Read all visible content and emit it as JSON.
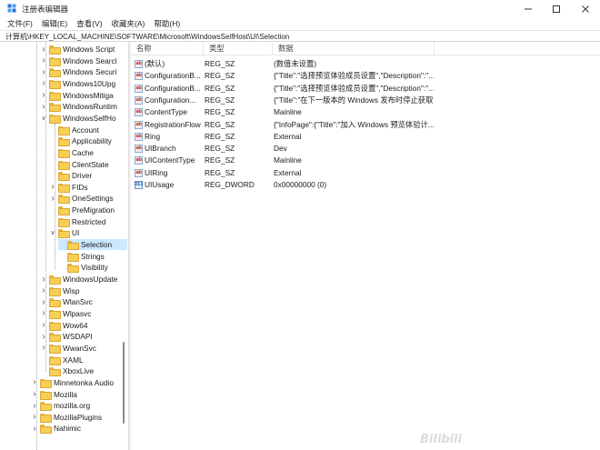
{
  "window": {
    "title": "注册表编辑器",
    "icons": {
      "app": "registry-editor-icon",
      "minimize": "minimize-icon",
      "maximize": "maximize-icon",
      "close": "close-icon"
    }
  },
  "menu": {
    "items": [
      {
        "label": "文件(F)"
      },
      {
        "label": "编辑(E)"
      },
      {
        "label": "查看(V)"
      },
      {
        "label": "收藏夹(A)"
      },
      {
        "label": "帮助(H)"
      }
    ]
  },
  "address": {
    "path": "计算机\\HKEY_LOCAL_MACHINE\\SOFTWARE\\Microsoft\\WindowsSelfHost\\UI\\Selection"
  },
  "tree": {
    "items": [
      {
        "label": "Windows Script",
        "expander": ">"
      },
      {
        "label": "Windows Searcl",
        "expander": ">"
      },
      {
        "label": "Windows Securi",
        "expander": ">"
      },
      {
        "label": "Windows10Upg",
        "expander": ">"
      },
      {
        "label": "WindowsMitiga",
        "expander": ">"
      },
      {
        "label": "WindowsRuntim",
        "expander": ">"
      },
      {
        "label": "WindowsSelfHo",
        "expander": "v"
      },
      {
        "label": "Account",
        "expander": ""
      },
      {
        "label": "Applicability",
        "expander": ""
      },
      {
        "label": "Cache",
        "expander": ""
      },
      {
        "label": "ClientState",
        "expander": ""
      },
      {
        "label": "Driver",
        "expander": ""
      },
      {
        "label": "FIDs",
        "expander": ">"
      },
      {
        "label": "OneSettings",
        "expander": ">"
      },
      {
        "label": "PreMigration",
        "expander": ""
      },
      {
        "label": "Restricted",
        "expander": ""
      },
      {
        "label": "UI",
        "expander": "v"
      },
      {
        "label": "Selection",
        "expander": "",
        "selected": true
      },
      {
        "label": "Strings",
        "expander": ""
      },
      {
        "label": "Visibility",
        "expander": ""
      },
      {
        "label": "WindowsUpdate",
        "expander": ">"
      },
      {
        "label": "Wisp",
        "expander": ">"
      },
      {
        "label": "WlanSvc",
        "expander": ">"
      },
      {
        "label": "Wlpasvc",
        "expander": ">"
      },
      {
        "label": "Wow64",
        "expander": ">"
      },
      {
        "label": "WSDAPI",
        "expander": ">"
      },
      {
        "label": "WwanSvc",
        "expander": ">"
      },
      {
        "label": "XAML",
        "expander": ""
      },
      {
        "label": "XboxLive",
        "expander": ""
      },
      {
        "label": "Minnetonka Audio",
        "expander": ">"
      },
      {
        "label": "Mozilla",
        "expander": ">"
      },
      {
        "label": "mozilla.org",
        "expander": ">"
      },
      {
        "label": "MozillaPlugins",
        "expander": ">"
      },
      {
        "label": "Nahimic",
        "expander": ">"
      }
    ]
  },
  "list": {
    "columns": {
      "name": "名称",
      "type": "类型",
      "data": "数据"
    },
    "rows": [
      {
        "name": "(默认)",
        "type": "REG_SZ",
        "data": "(数值未设置)",
        "icon": "ab"
      },
      {
        "name": "ConfigurationB...",
        "type": "REG_SZ",
        "data": "{\"Title\":\"选择预览体验成员设置\",\"Description\":\"...",
        "icon": "ab"
      },
      {
        "name": "ConfigurationB...",
        "type": "REG_SZ",
        "data": "{\"Title\":\"选择预览体验成员设置\",\"Description\":\"...",
        "icon": "ab"
      },
      {
        "name": "Configuration...",
        "type": "REG_SZ",
        "data": "{\"Title\":\"在下一版本的 Windows 发布时停止获取...",
        "icon": "ab"
      },
      {
        "name": "ContentType",
        "type": "REG_SZ",
        "data": "Mainline",
        "icon": "ab"
      },
      {
        "name": "RegistrationFlow",
        "type": "REG_SZ",
        "data": "{\"InfoPage\":{\"Title\":\"加入 Windows 预览体验计...",
        "icon": "ab"
      },
      {
        "name": "Ring",
        "type": "REG_SZ",
        "data": "External",
        "icon": "ab"
      },
      {
        "name": "UIBranch",
        "type": "REG_SZ",
        "data": "Dev",
        "icon": "ab"
      },
      {
        "name": "UIContentType",
        "type": "REG_SZ",
        "data": "Mainline",
        "icon": "ab"
      },
      {
        "name": "UIRing",
        "type": "REG_SZ",
        "data": "External",
        "icon": "ab"
      },
      {
        "name": "UIUsage",
        "type": "REG_DWORD",
        "data": "0x00000000 (0)",
        "icon": "011"
      }
    ]
  },
  "colors": {
    "selection": "#cce8ff",
    "folder": "#f7cf55"
  },
  "watermark": "Bilibili"
}
